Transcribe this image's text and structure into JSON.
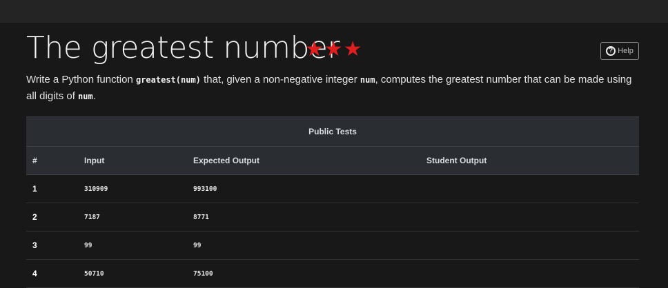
{
  "page": {
    "title": "The greatest number",
    "stars": "★★★",
    "help_label": "Help",
    "description": {
      "part1": "Write a Python function ",
      "code1": "greatest(num)",
      "part2": " that, given a non-negative integer ",
      "code2": "num",
      "part3": ", computes the greatest number that can be made using all digits of ",
      "code3": "num",
      "part4": "."
    }
  },
  "tests": {
    "caption": "Public Tests",
    "columns": [
      "#",
      "Input",
      "Expected Output",
      "Student Output"
    ],
    "rows": [
      {
        "num": "1",
        "input": "310909",
        "expected": "993100",
        "student": ""
      },
      {
        "num": "2",
        "input": "7187",
        "expected": "8771",
        "student": ""
      },
      {
        "num": "3",
        "input": "99",
        "expected": "99",
        "student": ""
      },
      {
        "num": "4",
        "input": "50710",
        "expected": "75100",
        "student": ""
      }
    ]
  },
  "colors": {
    "stars": "#e01e1e",
    "background": "#181818",
    "table_header": "#2a2e33"
  },
  "icons": {
    "help": "question-circle-icon"
  }
}
